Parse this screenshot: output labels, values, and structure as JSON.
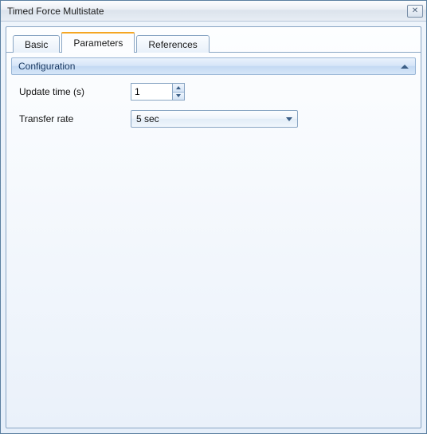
{
  "window": {
    "title": "Timed Force Multistate"
  },
  "tabs": {
    "basic": "Basic",
    "parameters": "Parameters",
    "references": "References",
    "active": "parameters"
  },
  "section": {
    "title": "Configuration"
  },
  "fields": {
    "update_time": {
      "label": "Update time (s)",
      "value": "1"
    },
    "transfer_rate": {
      "label": "Transfer rate",
      "value": "5 sec"
    }
  }
}
